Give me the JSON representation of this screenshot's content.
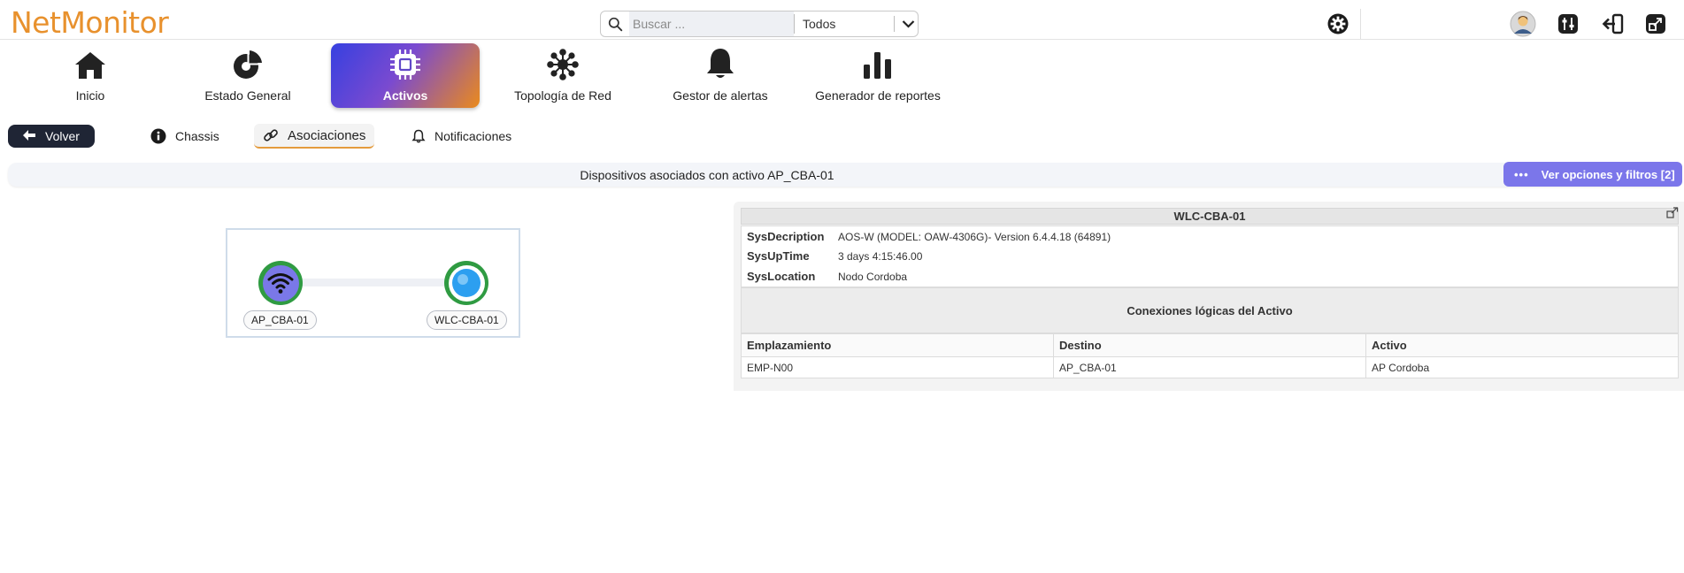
{
  "app": {
    "logo": "NetMonitor"
  },
  "search": {
    "placeholder": "Buscar ...",
    "scope": "Todos"
  },
  "nav": {
    "items": [
      {
        "label": "Inicio",
        "icon": "home-icon"
      },
      {
        "label": "Estado General",
        "icon": "pie-chart-icon"
      },
      {
        "label": "Activos",
        "icon": "chip-icon",
        "active": true
      },
      {
        "label": "Topología de Red",
        "icon": "network-icon"
      },
      {
        "label": "Gestor de alertas",
        "icon": "bell-icon"
      },
      {
        "label": "Generador de reportes",
        "icon": "bar-chart-icon"
      }
    ]
  },
  "subnav": {
    "back_label": "Volver",
    "tabs": [
      {
        "label": "Chassis",
        "icon": "info-icon"
      },
      {
        "label": "Asociaciones",
        "icon": "link-icon",
        "active": true
      },
      {
        "label": "Notificaciones",
        "icon": "bell-icon"
      }
    ]
  },
  "titlebar": {
    "text": "Dispositivos asociados con activo AP_CBA-01",
    "options_label": "Ver opciones y filtros [2]"
  },
  "graph": {
    "nodes": [
      {
        "label": "AP_CBA-01",
        "icon": "wifi-icon"
      },
      {
        "label": "WLC-CBA-01",
        "icon": "controller-icon"
      }
    ]
  },
  "detail": {
    "title": "WLC-CBA-01",
    "sys": [
      {
        "key": "SysDecription",
        "value": "AOS-W (MODEL: OAW-4306G)- Version 6.4.4.18 (64891)"
      },
      {
        "key": "SysUpTime",
        "value": "3 days 4:15:46.00"
      },
      {
        "key": "SysLocation",
        "value": "Nodo Cordoba"
      }
    ],
    "connections_title": "Conexiones lógicas del Activo",
    "columns": [
      "Emplazamiento",
      "Destino",
      "Activo"
    ],
    "rows": [
      [
        "EMP-N00",
        "AP_CBA-01",
        "AP Cordoba"
      ]
    ]
  },
  "colors": {
    "brand": "#e8912d",
    "accent_button": "#7b76ea",
    "node_ring": "#2f9b42",
    "back_button": "#1f2535"
  }
}
